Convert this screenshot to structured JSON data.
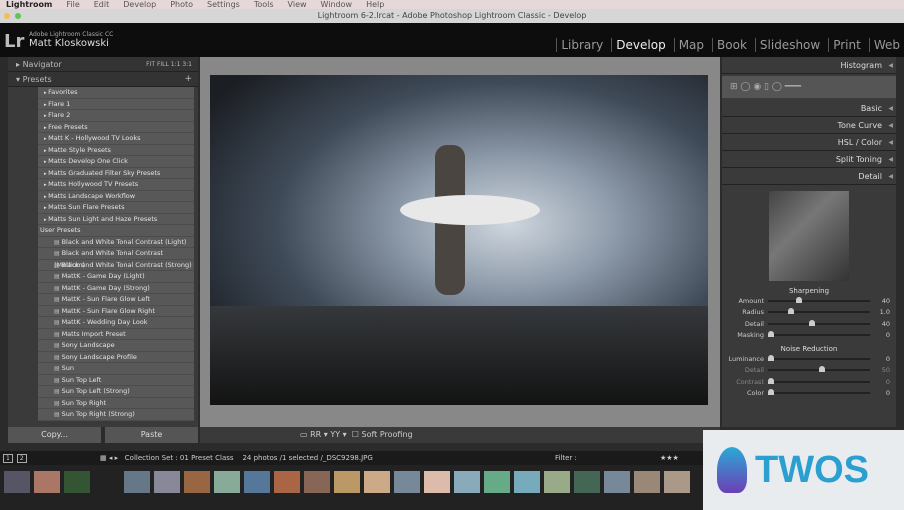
{
  "menubar": {
    "items": [
      "Lightroom",
      "File",
      "Edit",
      "Develop",
      "Photo",
      "Settings",
      "Tools",
      "View",
      "Window",
      "Help"
    ]
  },
  "window_title": "Lightroom 6-2.lrcat - Adobe Photoshop Lightroom Classic - Develop",
  "identity": {
    "logo": "Lr",
    "product": "Adobe Lightroom Classic CC",
    "user": "Matt Kloskowski"
  },
  "modules": [
    {
      "label": "Library"
    },
    {
      "label": "Develop",
      "active": true
    },
    {
      "label": "Map"
    },
    {
      "label": "Book"
    },
    {
      "label": "Slideshow"
    },
    {
      "label": "Print"
    },
    {
      "label": "Web"
    }
  ],
  "left": {
    "navigator": "Navigator",
    "nav_zoom": "FIT  FILL  1:1  3:1",
    "presets": "Presets",
    "folders": [
      "Favorites",
      "Flare 1",
      "Flare 2",
      "Free Presets",
      "Matt K - Hollywood TV Looks",
      "Matte Style Presets",
      "Matts Develop One Click",
      "Matts Graduated Filter Sky Presets",
      "Matts Hollywood TV Presets",
      "Matts Landscape Workflow",
      "Matts Sun Flare Presets",
      "Matts Sun Light and Haze Presets"
    ],
    "user_folder": "User Presets",
    "user_presets": [
      "Black and White Tonal Contrast (Light)",
      "Black and White Tonal Contrast (Medium)",
      "Black and White Tonal Contrast (Strong)",
      "MattK - Game Day (Light)",
      "MattK - Game Day (Strong)",
      "MattK - Sun Flare Glow Left",
      "MattK - Sun Flare Glow Right",
      "MattK - Wedding Day Look",
      "Matts Import Preset",
      "Sony Landscape",
      "Sony Landscape Profile",
      "Sun",
      "Sun Top Left",
      "Sun Top Left (Strong)",
      "Sun Top Right",
      "Sun Top Right (Strong)"
    ],
    "copy": "Copy...",
    "paste": "Paste"
  },
  "toolbar": {
    "soft_proofing": "Soft Proofing"
  },
  "right": {
    "panels": [
      "Histogram",
      "Basic",
      "Tone Curve",
      "HSL / Color",
      "Split Toning",
      "Detail"
    ],
    "sharpening": {
      "title": "Sharpening",
      "sliders": [
        {
          "label": "Amount",
          "value": "40",
          "pct": 0.27
        },
        {
          "label": "Radius",
          "value": "1.0",
          "pct": 0.2
        },
        {
          "label": "Detail",
          "value": "40",
          "pct": 0.4
        },
        {
          "label": "Masking",
          "value": "0",
          "pct": 0
        }
      ]
    },
    "noise": {
      "title": "Noise Reduction",
      "sliders": [
        {
          "label": "Luminance",
          "value": "0",
          "pct": 0
        },
        {
          "label": "Detail",
          "value": "50",
          "pct": 0.5,
          "dim": true
        },
        {
          "label": "Contrast",
          "value": "0",
          "pct": 0,
          "dim": true
        },
        {
          "label": "Color",
          "value": "0",
          "pct": 0
        }
      ]
    }
  },
  "filmstrip": {
    "pages": [
      "1",
      "2"
    ],
    "source": "Collection Set : 01 Preset Class",
    "count": "24 photos /1 selected /_DSC9298.JPG",
    "filter": "Filter :"
  },
  "watermark": "TWOS"
}
